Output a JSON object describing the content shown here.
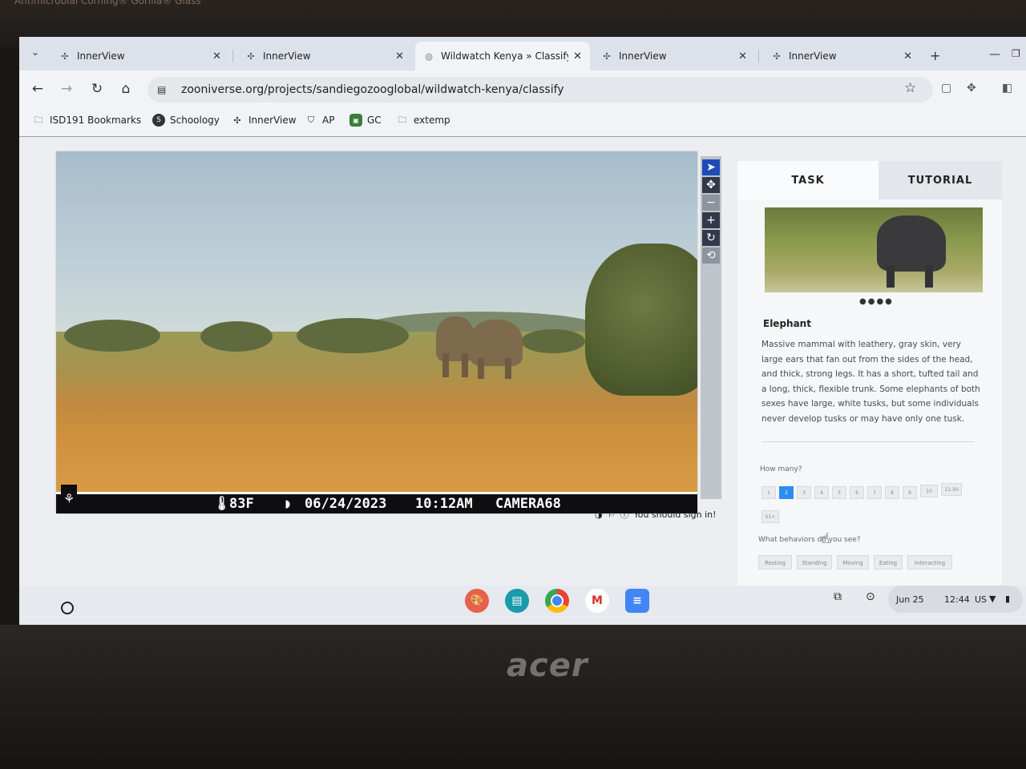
{
  "bezel": {
    "top_text": "Antimicrobial Corning® Gorilla® Glass",
    "brand": "acer"
  },
  "browser": {
    "tabs": [
      {
        "title": "InnerView",
        "active": false
      },
      {
        "title": "InnerView",
        "active": false
      },
      {
        "title": "Wildwatch Kenya » Classify",
        "active": true
      },
      {
        "title": "InnerView",
        "active": false
      },
      {
        "title": "InnerView",
        "active": false
      }
    ],
    "url": "zooniverse.org/projects/sandiegozooglobal/wildwatch-kenya/classify",
    "bookmarks": [
      {
        "label": "ISD191 Bookmarks",
        "icon": "folder-bookmark-icon"
      },
      {
        "label": "Schoology",
        "icon": "schoology-icon"
      },
      {
        "label": "InnerView",
        "icon": "innerview-icon"
      },
      {
        "label": "AP",
        "icon": "ap-icon"
      },
      {
        "label": "GC",
        "icon": "gc-icon"
      },
      {
        "label": "extemp",
        "icon": "folder-icon"
      }
    ]
  },
  "subject": {
    "temperature": "83F",
    "date": "06/24/2023",
    "time": "10:12AM",
    "camera": "CAMERA68",
    "sign_in_notice": "You should sign in!"
  },
  "task_panel": {
    "tabs": {
      "task": "TASK",
      "tutorial": "TUTORIAL"
    },
    "species_name": "Elephant",
    "species_description": "Massive mammal with leathery, gray skin, very large ears that fan out from the sides of the head, and thick, strong legs. It has a short, tufted tail and a long, thick, flexible trunk. Some elephants of both sexes have large, white tusks, but some individuals never develop tusks or may have only one tusk.",
    "how_many_label": "How many?",
    "count_options": [
      "1",
      "2",
      "3",
      "4",
      "5",
      "6",
      "7",
      "8",
      "9",
      "10",
      "11-50",
      "51+"
    ],
    "selected_count": "2",
    "behaviors_label": "What behaviors do you see?",
    "behavior_options": [
      "Resting",
      "Standing",
      "Moving",
      "Eating",
      "Interacting"
    ]
  },
  "shelf": {
    "date": "Jun 25",
    "time": "12:44",
    "locale": "US"
  },
  "colors": {
    "accent": "#2b8ef0",
    "tool_selected": "#1f4bb8"
  }
}
